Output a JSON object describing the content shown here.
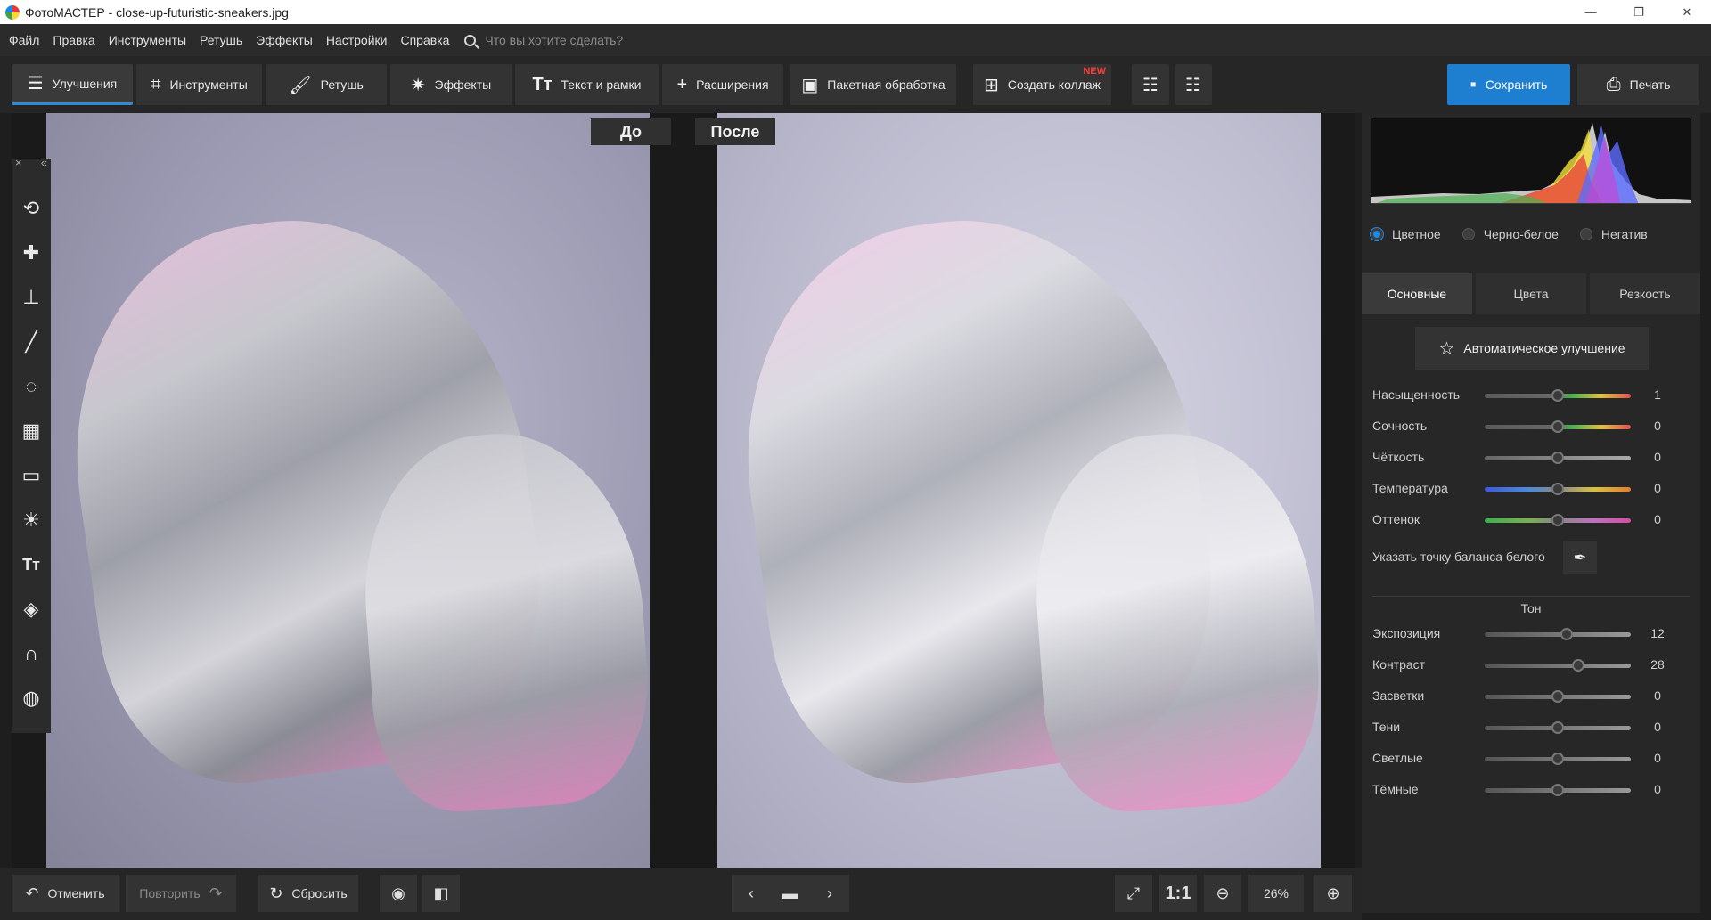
{
  "title": "ФотоМАСТЕР - close-up-futuristic-sneakers.jpg",
  "window_controls": [
    "—",
    "❐",
    "✕"
  ],
  "menu": [
    "Файл",
    "Правка",
    "Инструменты",
    "Ретушь",
    "Эффекты",
    "Настройки",
    "Справка"
  ],
  "search_placeholder": "Что вы хотите сделать?",
  "toolbar": {
    "tabs": [
      {
        "label": "Улучшения",
        "icon": "sliders-icon"
      },
      {
        "label": "Инструменты",
        "icon": "crop-icon"
      },
      {
        "label": "Ретушь",
        "icon": "brush-icon"
      },
      {
        "label": "Эффекты",
        "icon": "sparkle-icon"
      },
      {
        "label": "Текст и рамки",
        "icon": "text-icon"
      },
      {
        "label": "Расширения",
        "icon": "plus-icon"
      },
      {
        "label": "Пакетная обработка",
        "icon": "images-icon"
      },
      {
        "label": "Создать коллаж",
        "icon": "collage-icon"
      }
    ],
    "new_badge": "NEW",
    "save_label": "Сохранить",
    "print_label": "Печать"
  },
  "compare": {
    "before": "До",
    "after": "После"
  },
  "color_modes": [
    {
      "label": "Цветное",
      "selected": true
    },
    {
      "label": "Черно-белое",
      "selected": false
    },
    {
      "label": "Негатив",
      "selected": false
    }
  ],
  "panel_tabs": [
    "Основные",
    "Цвета",
    "Резкость"
  ],
  "auto_enhance_label": "Автоматическое улучшение",
  "color_sliders": [
    {
      "label": "Насыщенность",
      "value": "1",
      "pos": 0.5,
      "gradient": "linear-gradient(90deg,#5a5a5a,#666 45%,#4caf50 60%,#e0c040 80%,#e05050)"
    },
    {
      "label": "Сочность",
      "value": "0",
      "pos": 0.5,
      "gradient": "linear-gradient(90deg,#5a5a5a,#666 45%,#4caf50 60%,#e0c040 80%,#e05050)"
    },
    {
      "label": "Чёткость",
      "value": "0",
      "pos": 0.5,
      "gradient": "linear-gradient(90deg,#666,#888 50%,#aaa)"
    },
    {
      "label": "Температура",
      "value": "0",
      "pos": 0.5,
      "gradient": "linear-gradient(90deg,#3c5bd8,#4a8bd8 30%,#888 50%,#d8c040 75%,#e08030)"
    },
    {
      "label": "Оттенок",
      "value": "0",
      "pos": 0.5,
      "gradient": "linear-gradient(90deg,#3caf50,#7aaf50 30%,#888 50%,#c070c0 75%,#d050a0)"
    }
  ],
  "white_balance_label": "Указать точку баланса белого",
  "tone_header": "Тон",
  "tone_sliders": [
    {
      "label": "Экспозиция",
      "value": "12",
      "pos": 0.56
    },
    {
      "label": "Контраст",
      "value": "28",
      "pos": 0.64
    },
    {
      "label": "Засветки",
      "value": "0",
      "pos": 0.5
    },
    {
      "label": "Тени",
      "value": "0",
      "pos": 0.5
    },
    {
      "label": "Светлые",
      "value": "0",
      "pos": 0.5
    },
    {
      "label": "Тёмные",
      "value": "0",
      "pos": 0.5
    }
  ],
  "bottom": {
    "undo_label": "Отменить",
    "redo_label": "Повторить",
    "reset_label": "Сбросить",
    "one_to_one": "1:1",
    "zoom_value": "26%"
  },
  "colors": {
    "accent": "#1e88e5",
    "save_button": "#1e7fd0",
    "new_badge": "#ff3a3a"
  }
}
